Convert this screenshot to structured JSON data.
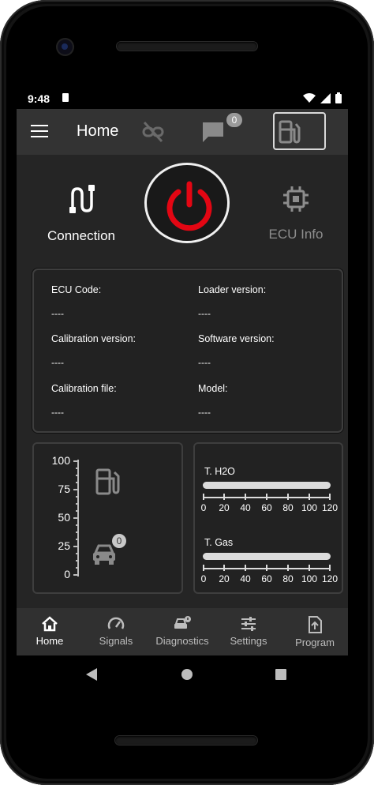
{
  "status_bar": {
    "time": "9:48"
  },
  "app_bar": {
    "title": "Home",
    "chat_badge": "0"
  },
  "hero": {
    "connection_label": "Connection",
    "ecu_info_label": "ECU Info"
  },
  "ecu_info": {
    "fields": [
      {
        "label": "ECU Code:",
        "value": "----"
      },
      {
        "label": "Loader version:",
        "value": "----"
      },
      {
        "label": "Calibration version:",
        "value": "----"
      },
      {
        "label": "Software version:",
        "value": "----"
      },
      {
        "label": "Calibration file:",
        "value": "----"
      },
      {
        "label": "Model:",
        "value": "----"
      }
    ]
  },
  "fuel_gauge": {
    "ticks": [
      "100",
      "75",
      "50",
      "25",
      "0"
    ],
    "badge": "0"
  },
  "temperatures": {
    "h2o_label": "T. H2O",
    "gas_label": "T. Gas",
    "scale": [
      "0",
      "20",
      "40",
      "60",
      "80",
      "100",
      "120"
    ]
  },
  "bottom_nav": {
    "items": [
      {
        "label": "Home",
        "icon": "home-icon"
      },
      {
        "label": "Signals",
        "icon": "speedometer-icon"
      },
      {
        "label": "Diagnostics",
        "icon": "car-alert-icon"
      },
      {
        "label": "Settings",
        "icon": "tune-icon"
      },
      {
        "label": "Program",
        "icon": "file-upload-icon"
      }
    ]
  },
  "colors": {
    "accent_red": "#e30613",
    "background": "#252525",
    "app_bar": "#333333"
  }
}
